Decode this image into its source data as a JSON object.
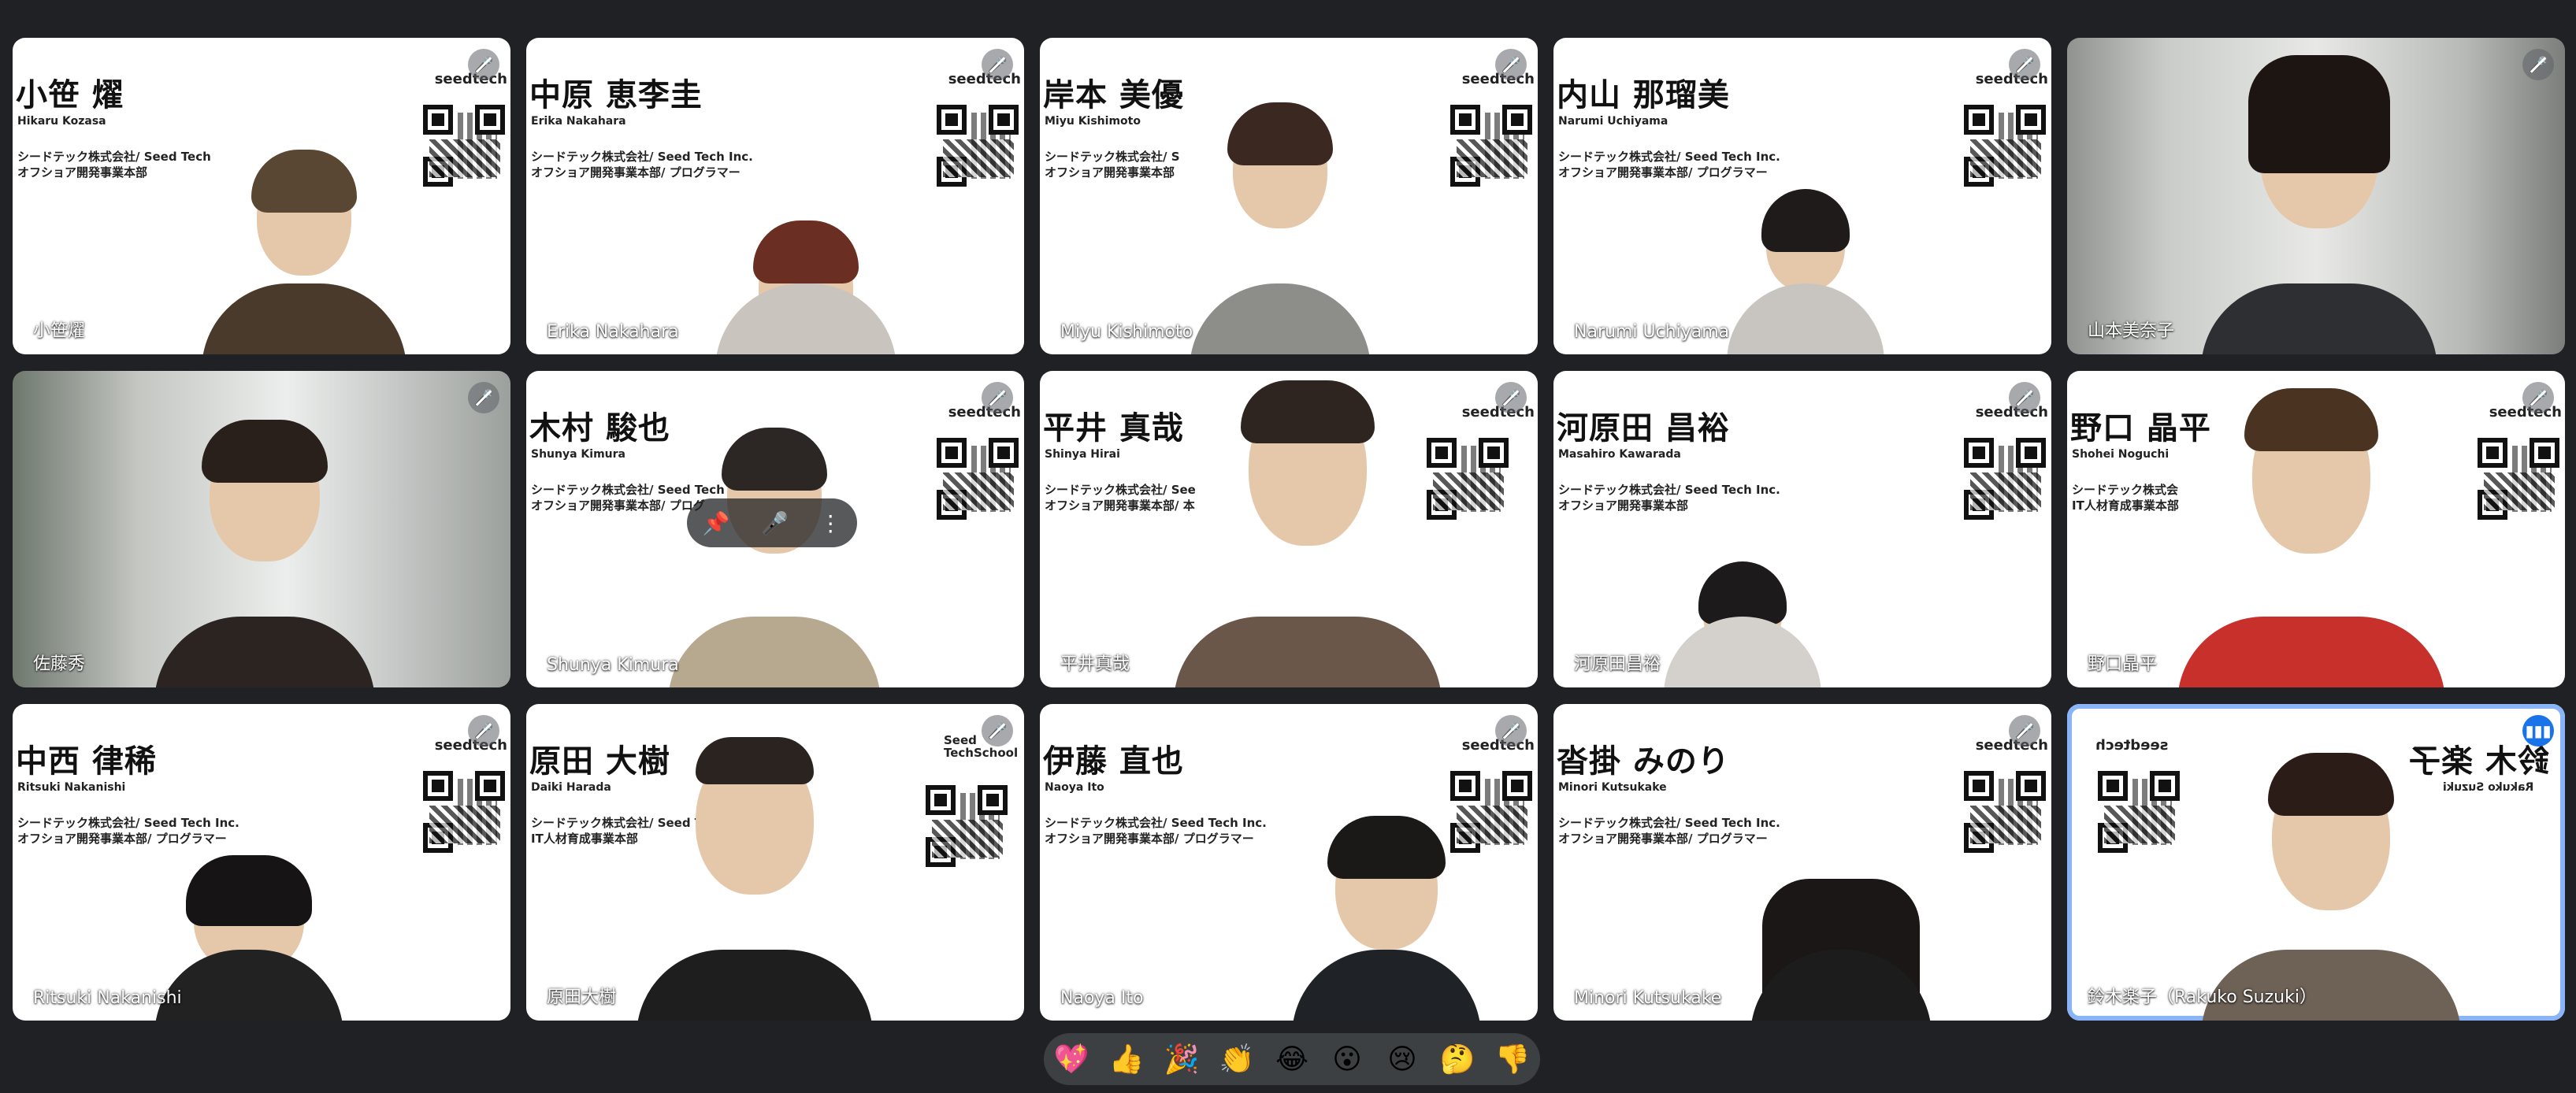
{
  "tiles": [
    {
      "card_name": "小笹 燿",
      "card_roman": "Hikaru Kozasa",
      "card_company": "シードテック株式会社/ Seed Tech",
      "card_dept": "オフショア開発事業本部",
      "logo": "seedtech",
      "label": "小笹燿",
      "muted": true
    },
    {
      "card_name": "中原 恵李圭",
      "card_roman": "Erika Nakahara",
      "card_company": "シードテック株式会社/ Seed Tech Inc.",
      "card_dept": "オフショア開発事業本部/ プログラマー",
      "logo": "seedtech",
      "label": "Erika Nakahara",
      "muted": true
    },
    {
      "card_name": "岸本 美優",
      "card_roman": "Miyu Kishimoto",
      "card_company": "シードテック株式会社/ S",
      "card_dept": "オフショア開発事業本部",
      "logo": "seedtech",
      "label": "Miyu Kishimoto",
      "muted": true
    },
    {
      "card_name": "内山 那瑠美",
      "card_roman": "Narumi Uchiyama",
      "card_company": "シードテック株式会社/ Seed Tech Inc.",
      "card_dept": "オフショア開発事業本部/ プログラマー",
      "logo": "seedtech",
      "label": "Narumi Uchiyama",
      "muted": true
    },
    {
      "card_name": "",
      "card_roman": "",
      "card_company": "",
      "card_dept": "",
      "logo": "",
      "label": "山本美奈子",
      "muted": true,
      "dark": true
    },
    {
      "card_name": "",
      "card_roman": "",
      "card_company": "",
      "card_dept": "",
      "logo": "",
      "label": "佐藤秀",
      "muted": true,
      "dark": true
    },
    {
      "card_name": "木村 駿也",
      "card_roman": "Shunya Kimura",
      "card_company": "シードテック株式会社/ Seed Tech",
      "card_dept": "オフショア開発事業本部/ プログ",
      "logo": "seedtech",
      "label": "Shunya Kimura",
      "muted": true
    },
    {
      "card_name": "平井 真哉",
      "card_roman": "Shinya Hirai",
      "card_company": "シードテック株式会社/ See",
      "card_dept": "オフショア開発事業本部/ 本",
      "logo": "seedtech",
      "label": "平井真哉",
      "muted": true
    },
    {
      "card_name": "河原田 昌裕",
      "card_roman": "Masahiro Kawarada",
      "card_company": "シードテック株式会社/ Seed Tech Inc.",
      "card_dept": "オフショア開発事業本部",
      "logo": "seedtech",
      "label": "河原田昌裕",
      "muted": true
    },
    {
      "card_name": "野口 晶平",
      "card_roman": "Shohei Noguchi",
      "card_company": "シードテック株式会",
      "card_dept": "IT人材育成事業本部",
      "logo": "seedtech",
      "label": "野口晶平",
      "muted": true
    },
    {
      "card_name": "中西 律稀",
      "card_roman": "Ritsuki Nakanishi",
      "card_company": "シードテック株式会社/ Seed Tech Inc.",
      "card_dept": "オフショア開発事業本部/ プログラマー",
      "logo": "seedtech",
      "label": "Ritsuki Nakanishi",
      "muted": true
    },
    {
      "card_name": "原田 大樹",
      "card_roman": "Daiki Harada",
      "card_company": "シードテック株式会社/ Seed Tech In",
      "card_dept": "IT人材育成事業本部",
      "logo": "Seed TechSchool",
      "label": "原田大樹",
      "muted": true
    },
    {
      "card_name": "伊藤 直也",
      "card_roman": "Naoya Ito",
      "card_company": "シードテック株式会社/ Seed Tech Inc.",
      "card_dept": "オフショア開発事業本部/ プログラマー",
      "logo": "seedtech",
      "label": "Naoya Ito",
      "muted": true
    },
    {
      "card_name": "沓掛 みのり",
      "card_roman": "Minori Kutsukake",
      "card_company": "シードテック株式会社/ Seed Tech Inc.",
      "card_dept": "オフショア開発事業本部/ プログラマー",
      "logo": "seedtech",
      "label": "Minori Kutsukake",
      "muted": true
    },
    {
      "card_name": "鈴木 楽子",
      "card_roman": "Rakuko Suzuki",
      "card_company": "",
      "card_dept": "",
      "logo": "seedtech",
      "label": "鈴木楽子（Rakuko Suzuki）",
      "muted": false,
      "active": true
    }
  ],
  "reactions": [
    "💖",
    "👍",
    "🎉",
    "👏",
    "😂",
    "😮",
    "😢",
    "🤔",
    "👎"
  ],
  "icons": {
    "mic_off": "mic-off-icon",
    "mic_on": "speaking-icon",
    "pin": "pin-icon",
    "more": "more-vert-icon"
  }
}
